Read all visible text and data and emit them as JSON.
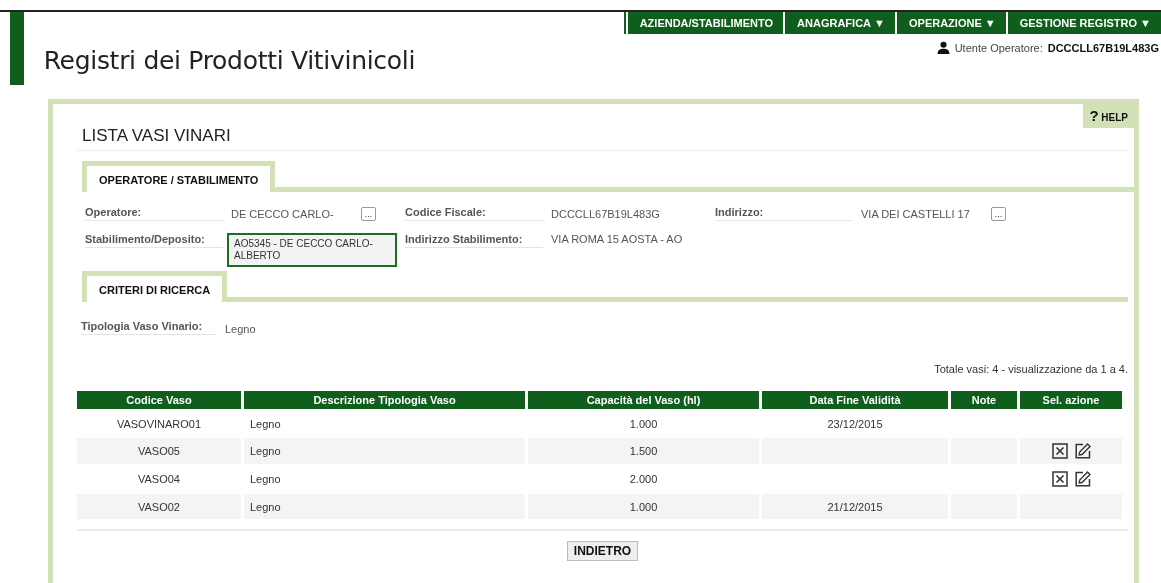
{
  "nav": [
    {
      "label": "AZIENDA/STABILIMENTO",
      "dropdown": false
    },
    {
      "label": "ANAGRAFICA",
      "dropdown": true
    },
    {
      "label": "OPERAZIONE",
      "dropdown": true
    },
    {
      "label": "GESTIONE REGISTRO",
      "dropdown": true
    }
  ],
  "dropdown_glyph": "▼",
  "app_title": "Registri dei Prodotti Vitivinicoli",
  "user": {
    "label": "Utente Operatore:",
    "value": "DCCCLL67B19L483G"
  },
  "help": {
    "glyph": "?",
    "label": "HELP"
  },
  "page_title": "LISTA VASI VINARI",
  "operator_section": {
    "tab": "OPERATORE / STABILIMENTO",
    "row1": [
      {
        "label": "Operatore:",
        "value": "DE CECCO CARLO-",
        "lookup": true,
        "button": "..."
      },
      {
        "label": "Codice Fiscale:",
        "value": "DCCCLL67B19L483G",
        "lookup": false
      },
      {
        "label": "Indirizzo:",
        "value": "VIA DEI CASTELLI 17",
        "lookup": true,
        "button": "..."
      }
    ],
    "row2": [
      {
        "label": "Stabilimento/Deposito:",
        "value": "AO5345 - DE CECCO CARLO-ALBERTO",
        "kind": "box"
      },
      {
        "label": "Indirizzo Stabilimento:",
        "value": "VIA ROMA 15 AOSTA -  AO",
        "kind": "text"
      }
    ]
  },
  "criteria_section": {
    "tab": "CRITERI DI RICERCA",
    "label": "Tipologia Vaso Vinario:",
    "value": "Legno"
  },
  "summary": "Totale vasi: 4 - visualizzazione da 1 a 4.",
  "table": {
    "columns": [
      "Codice Vaso",
      "Descrizione Tipologia Vaso",
      "Capacità del Vaso (hl)",
      "Data Fine Validità",
      "Note",
      "Sel. azione"
    ],
    "rows": [
      {
        "code": "VASOVINARO01",
        "description": "Legno",
        "capacity": "1.000",
        "end_date": "23/12/2015",
        "actions": false
      },
      {
        "code": "VASO05",
        "description": "Legno",
        "capacity": "1.500",
        "actions": true
      },
      {
        "code": "VASO04",
        "description": "Legno",
        "capacity": "2.000",
        "actions": true
      },
      {
        "code": "VASO02",
        "description": "Legno",
        "capacity": "1.000",
        "end_date": "21/12/2015",
        "actions": false
      }
    ]
  },
  "back_button": "INDIETRO"
}
